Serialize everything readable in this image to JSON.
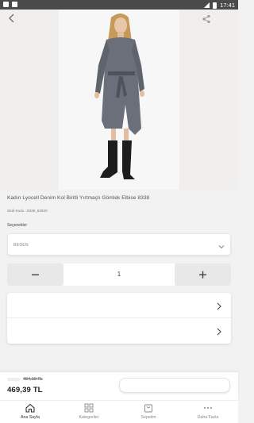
{
  "status_bar": {
    "time": "17:41"
  },
  "product": {
    "title": "Kadın Lyocell Denim Kol Biritli Yırtmaçlı Gömlek Elbise 8338",
    "stock_code": "Stok Kodu : 8338_62920",
    "options_label": "Seçenekler",
    "size_select": {
      "value": "BEDEN"
    },
    "quantity": "1",
    "old_price": "494,10 TL",
    "price": "469,39 TL"
  },
  "tabs": [
    {
      "label": "Ana Sayfa",
      "icon": "home-icon",
      "active": true
    },
    {
      "label": "Kategoriler",
      "icon": "grid-icon",
      "active": false
    },
    {
      "label": "Sepetim",
      "icon": "basket-icon",
      "active": false
    },
    {
      "label": "Daha Fazla",
      "icon": "more-icon",
      "active": false
    }
  ]
}
